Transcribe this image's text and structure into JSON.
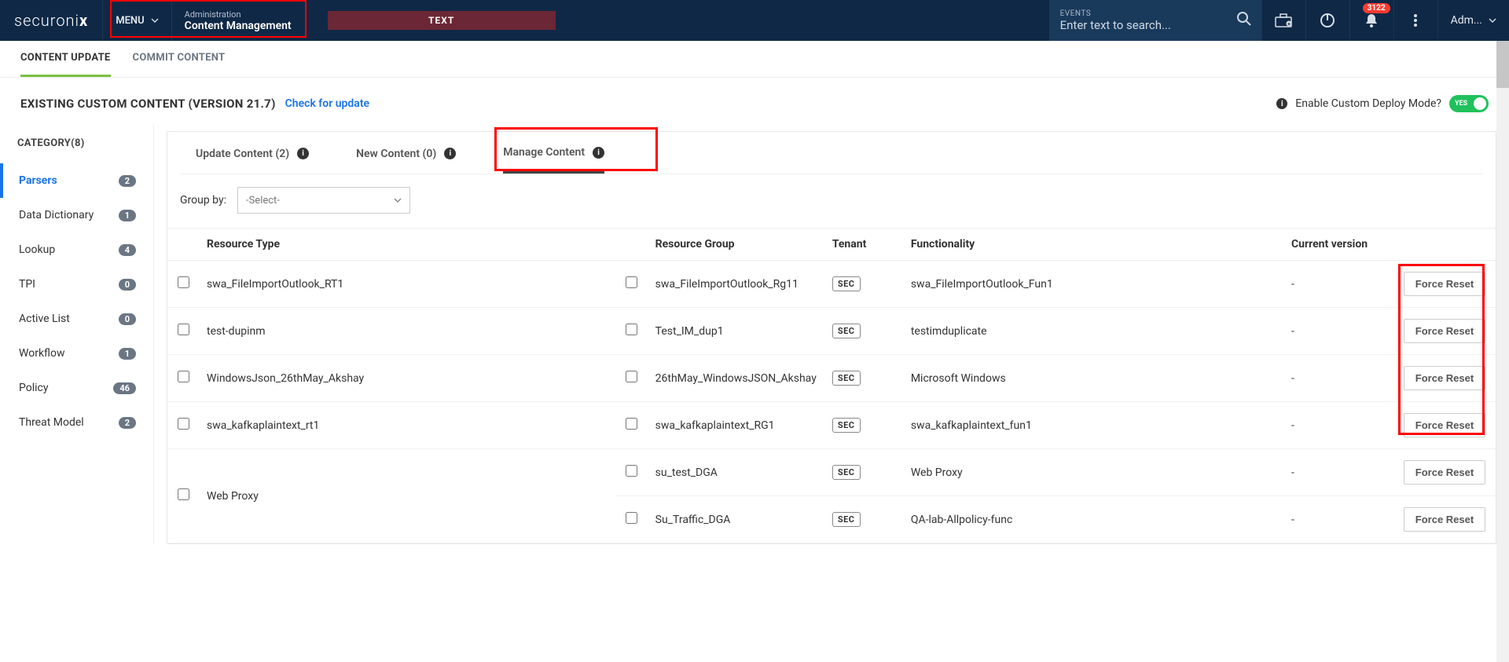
{
  "header": {
    "logo_light": "securoni",
    "logo_bold_x": "x",
    "menu": "MENU",
    "breadcrumb_small": "Administration",
    "breadcrumb_big": "Content Management",
    "text_pill": "TEXT",
    "search_label": "EVENTS",
    "search_placeholder": "Enter text to search...",
    "badge_count": "3122",
    "user": "Adm..."
  },
  "tabs": {
    "t1": "CONTENT UPDATE",
    "t2": "COMMIT CONTENT"
  },
  "title": {
    "main": "EXISTING CUSTOM CONTENT (VERSION 21.7)",
    "link": "Check for update",
    "deploy_label": "Enable Custom Deploy Mode?",
    "toggle_text": "YES"
  },
  "sidebar": {
    "heading": "CATEGORY(8)",
    "items": [
      {
        "label": "Parsers",
        "count": "2"
      },
      {
        "label": "Data Dictionary",
        "count": "1"
      },
      {
        "label": "Lookup",
        "count": "4"
      },
      {
        "label": "TPI",
        "count": "0"
      },
      {
        "label": "Active List",
        "count": "0"
      },
      {
        "label": "Workflow",
        "count": "1"
      },
      {
        "label": "Policy",
        "count": "46"
      },
      {
        "label": "Threat Model",
        "count": "2"
      }
    ]
  },
  "inner_tabs": {
    "t1": "Update Content (2)",
    "t2": "New Content (0)",
    "t3": "Manage Content"
  },
  "groupby": {
    "label": "Group by:",
    "placeholder": "-Select-"
  },
  "columns": {
    "c1": "Resource Type",
    "c2": "Resource Group",
    "c3": "Tenant",
    "c4": "Functionality",
    "c5": "Current version"
  },
  "rows": [
    {
      "rt": "swa_FileImportOutlook_RT1",
      "rg": "swa_FileImportOutlook_Rg11",
      "tn": "SEC",
      "fn": "swa_FileImportOutlook_Fun1",
      "cv": "-",
      "btn": "Force Reset"
    },
    {
      "rt": "test-dupinm",
      "rg": "Test_IM_dup1",
      "tn": "SEC",
      "fn": "testimduplicate",
      "cv": "-",
      "btn": "Force Reset"
    },
    {
      "rt": "WindowsJson_26thMay_Akshay",
      "rg": "26thMay_WindowsJSON_Akshay",
      "tn": "SEC",
      "fn": "Microsoft Windows",
      "cv": "-",
      "btn": "Force Reset"
    },
    {
      "rt": "swa_kafkaplaintext_rt1",
      "rg": "swa_kafkaplaintext_RG1",
      "tn": "SEC",
      "fn": "swa_kafkaplaintext_fun1",
      "cv": "-",
      "btn": "Force Reset"
    },
    {
      "rt": "Web Proxy",
      "rg": "su_test_DGA",
      "tn": "SEC",
      "fn": "Web Proxy",
      "cv": "-",
      "btn": "Force Reset",
      "rowspan": true
    },
    {
      "rt": "",
      "rg": "Su_Traffic_DGA",
      "tn": "SEC",
      "fn": "QA-lab-Allpolicy-func",
      "cv": "-",
      "btn": "Force Reset",
      "skip_rt": true
    }
  ]
}
